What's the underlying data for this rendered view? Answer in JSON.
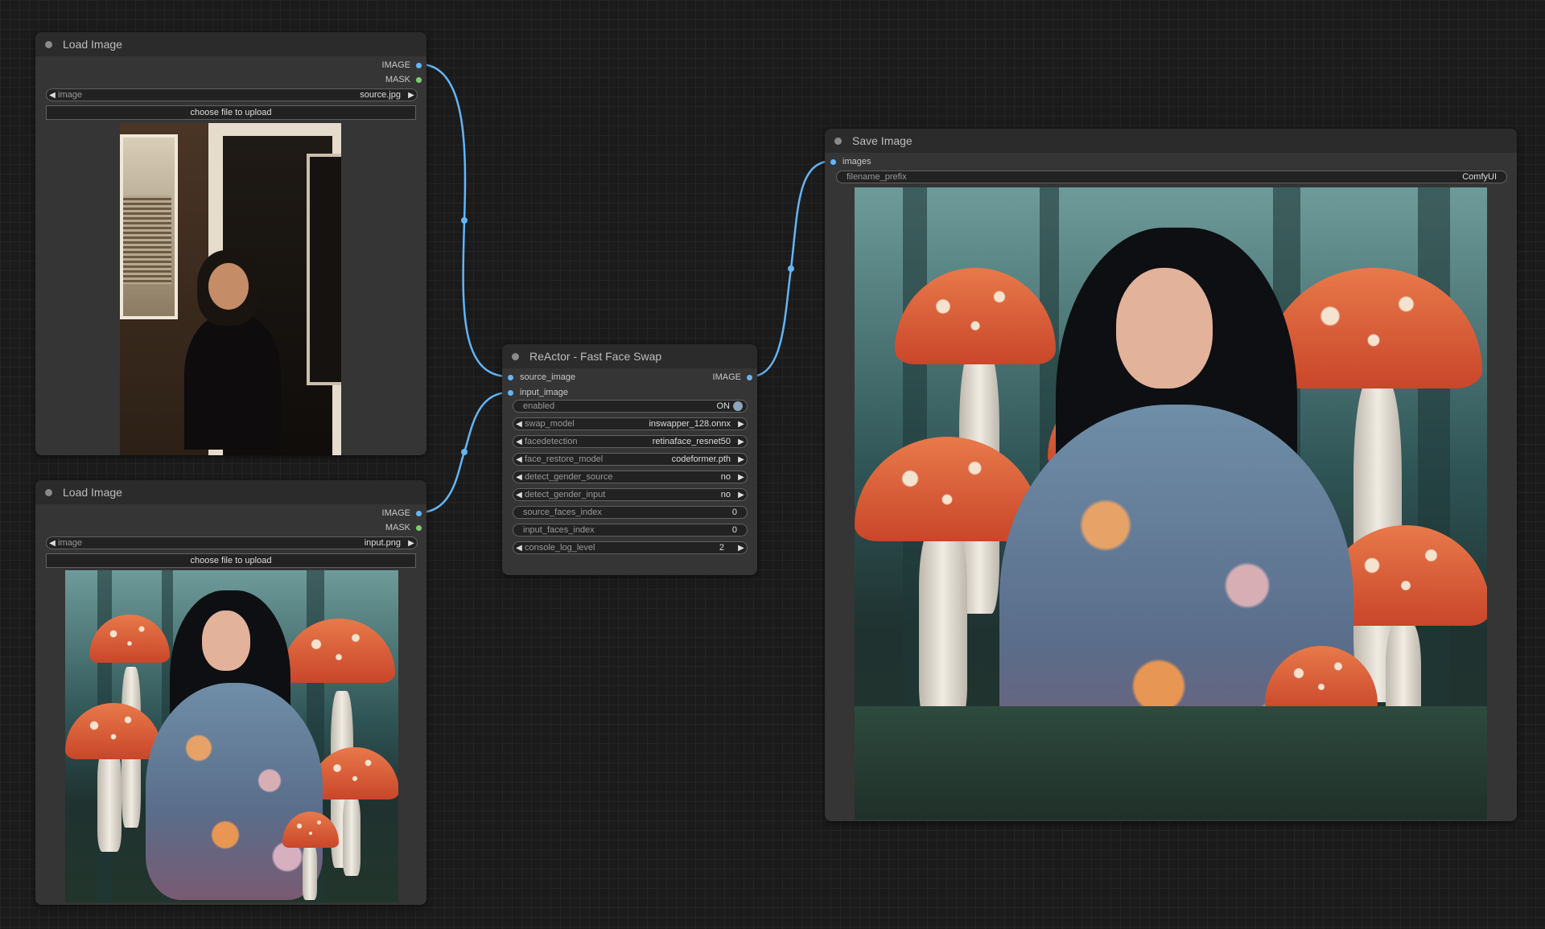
{
  "nodes": {
    "load_image_1": {
      "title": "Load Image",
      "outputs": [
        "IMAGE",
        "MASK"
      ],
      "image_widget": {
        "label": "image",
        "value": "source.jpg"
      },
      "upload_label": "choose file to upload"
    },
    "load_image_2": {
      "title": "Load Image",
      "outputs": [
        "IMAGE",
        "MASK"
      ],
      "image_widget": {
        "label": "image",
        "value": "input.png"
      },
      "upload_label": "choose file to upload"
    },
    "reactor": {
      "title": "ReActor - Fast Face Swap",
      "inputs": [
        "source_image",
        "input_image"
      ],
      "outputs": [
        "IMAGE"
      ],
      "widgets": [
        {
          "label": "enabled",
          "value": "ON"
        },
        {
          "label": "swap_model",
          "value": "inswapper_128.onnx"
        },
        {
          "label": "facedetection",
          "value": "retinaface_resnet50"
        },
        {
          "label": "face_restore_model",
          "value": "codeformer.pth"
        },
        {
          "label": "detect_gender_source",
          "value": "no"
        },
        {
          "label": "detect_gender_input",
          "value": "no"
        },
        {
          "label": "source_faces_index",
          "value": "0"
        },
        {
          "label": "input_faces_index",
          "value": "0"
        },
        {
          "label": "console_log_level",
          "value": "2"
        }
      ]
    },
    "save_image": {
      "title": "Save Image",
      "inputs": [
        "images"
      ],
      "widgets": [
        {
          "label": "filename_prefix",
          "value": "ComfyUI"
        }
      ]
    }
  },
  "colors": {
    "wire_image": "#64b5f6",
    "slot_mask": "#7ccf6e",
    "canvas": "#1b1b1b",
    "node_bg": "#353535"
  },
  "arrow_left": "◀",
  "arrow_right": "▶"
}
